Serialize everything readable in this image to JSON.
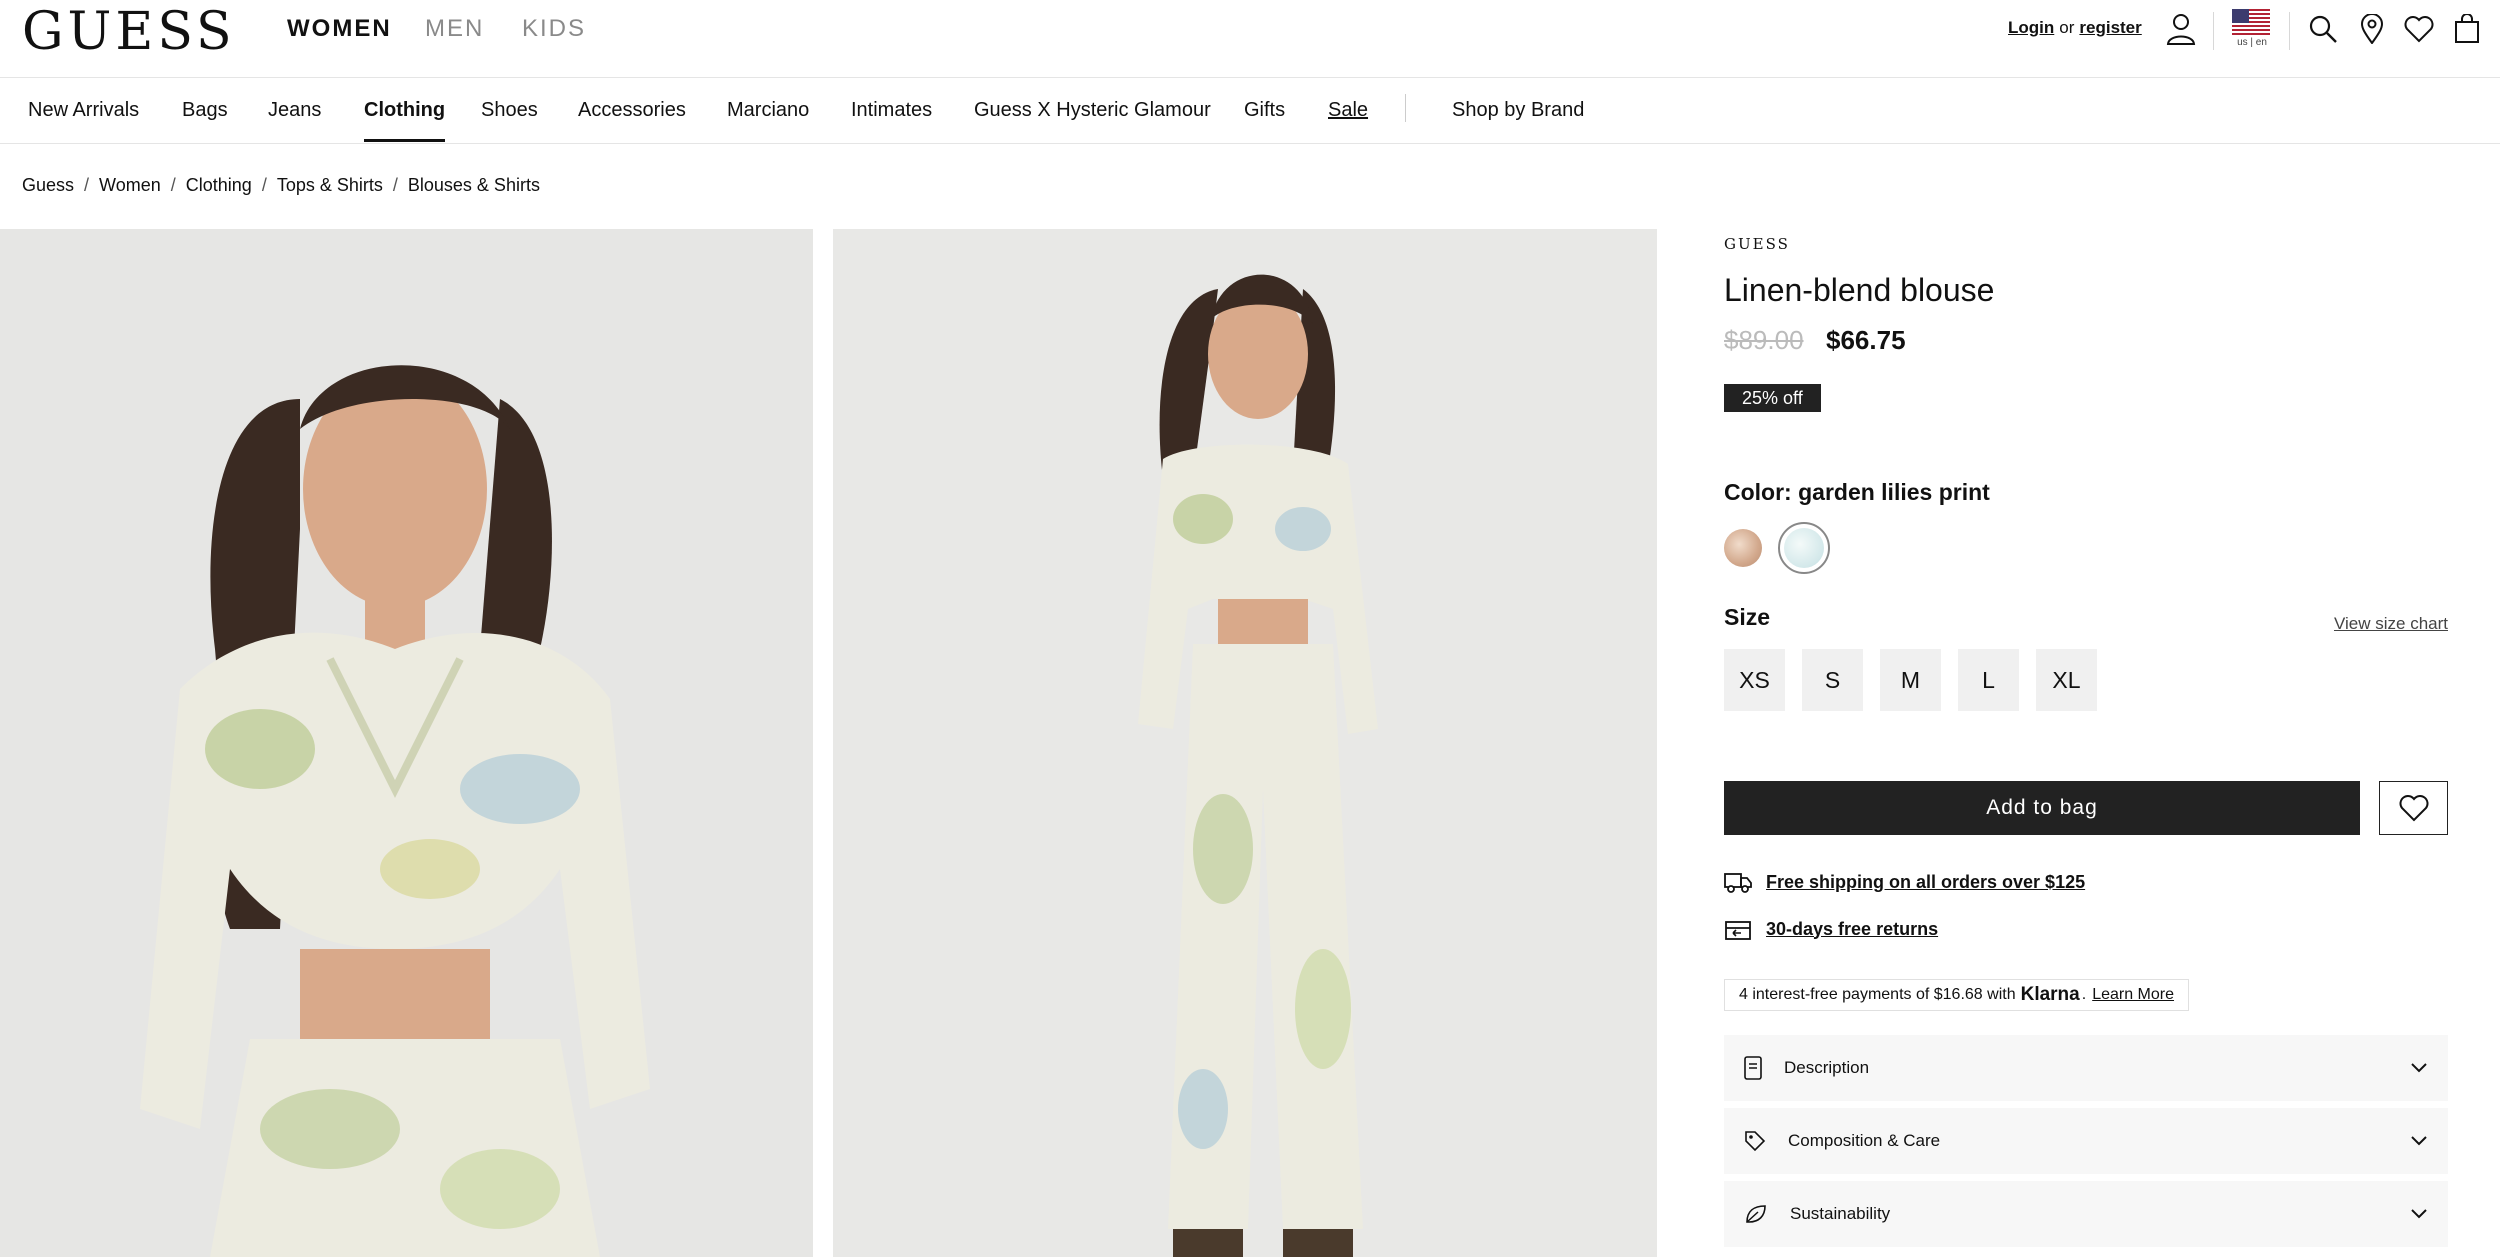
{
  "header": {
    "logo": "GUESS",
    "departments": [
      "WOMEN",
      "MEN",
      "KIDS"
    ],
    "login": "Login",
    "or": "or",
    "register": "register",
    "locale": "us | en"
  },
  "nav": {
    "items": [
      "New Arrivals",
      "Bags",
      "Jeans",
      "Clothing",
      "Shoes",
      "Accessories",
      "Marciano",
      "Intimates",
      "Guess X Hysteric Glamour",
      "Gifts",
      "Sale",
      "Shop by Brand"
    ],
    "active": "Clothing"
  },
  "breadcrumb": [
    "Guess",
    "Women",
    "Clothing",
    "Tops & Shirts",
    "Blouses & Shirts"
  ],
  "product": {
    "brand": "GUESS",
    "title": "Linen-blend blouse",
    "original_price": "$89.00",
    "sale_price": "$66.75",
    "discount": "25% off",
    "color_label": "Color: garden lilies print",
    "swatch_colors": [
      "#d8b8a0",
      "#cfe3e6"
    ],
    "size_label": "Size",
    "size_chart": "View size chart",
    "sizes": [
      "XS",
      "S",
      "M",
      "L",
      "XL"
    ],
    "add_to_bag": "Add to bag",
    "shipping": "Free shipping on all orders over $125",
    "returns": "30-days free returns",
    "klarna_prefix": "4 interest-free payments of $16.68 with",
    "klarna_brand": "Klarna",
    "klarna_dot": ".",
    "klarna_link": "Learn More",
    "accordions": [
      "Description",
      "Composition & Care",
      "Sustainability"
    ]
  },
  "colors": {
    "accent": "#222222",
    "photo_bg": "#e6e6e4"
  }
}
